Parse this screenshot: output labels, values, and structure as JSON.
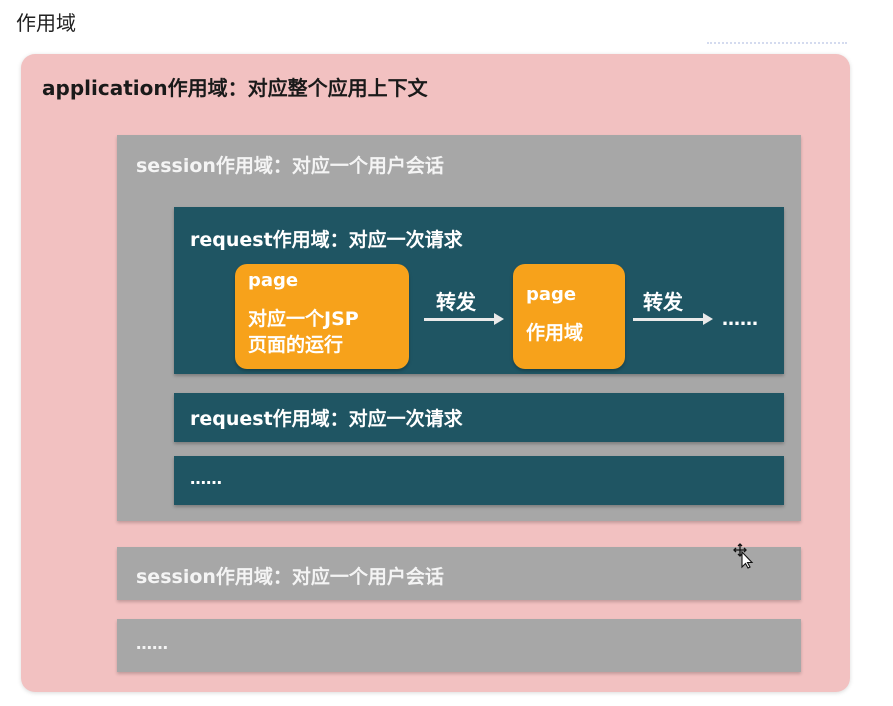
{
  "heading": "作用域",
  "application": {
    "title": "application作用域：对应整个应用上下文"
  },
  "sessions": [
    {
      "title": "session作用域：对应一个用户会话",
      "requests": [
        {
          "title": "request作用域：对应一次请求",
          "flow": {
            "page1_label": "page",
            "page1_desc_line1": "对应一个JSP",
            "page1_desc_line2": "页面的运行",
            "arrow1_label": "转发",
            "page2_label": "page",
            "page2_desc": "作用域",
            "arrow2_label": "转发",
            "tail": "……"
          }
        },
        {
          "title": "request作用域：对应一次请求"
        },
        {
          "title": "……"
        }
      ]
    },
    {
      "title": "session作用域：对应一个用户会话"
    },
    {
      "title": "……"
    }
  ],
  "colors": {
    "application_bg": "#f2c1c1",
    "session_bg": "#a7a7a7",
    "request_bg": "#1f5563",
    "page_bg": "#f7a21b"
  },
  "icons": {
    "cursor": "move-cursor-icon"
  }
}
